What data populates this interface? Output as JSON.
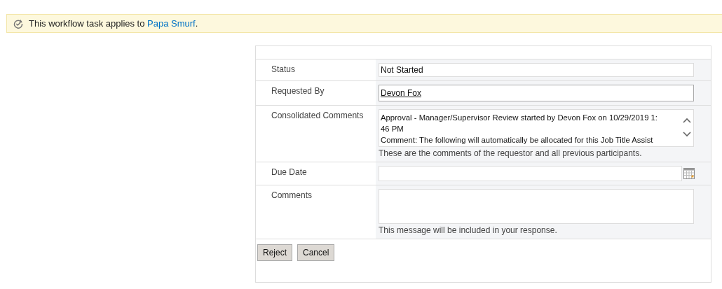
{
  "banner": {
    "text": "This workflow task applies to",
    "link": "Papa Smurf",
    "suffix": "."
  },
  "form": {
    "rows": [
      {
        "kind": "text",
        "label": "Status",
        "value": "Not Started"
      },
      {
        "kind": "person",
        "label": "Requested By",
        "value": "Devon Fox"
      },
      {
        "kind": "history",
        "label": "Consolidated Comments",
        "lines": [
          "Approval - Manager/Supervisor Review started by Devon Fox on 10/29/2019 1:",
          "46 PM",
          "Comment: The following will automatically be allocated for this Job Title Assist"
        ],
        "hint": "These are the comments of the requestor and all previous participants."
      },
      {
        "kind": "date",
        "label": "Due Date"
      },
      {
        "kind": "multiline",
        "label": "Comments",
        "hint": "This message will be included in your response."
      }
    ],
    "buttons": [
      "Reject",
      "Cancel"
    ]
  }
}
